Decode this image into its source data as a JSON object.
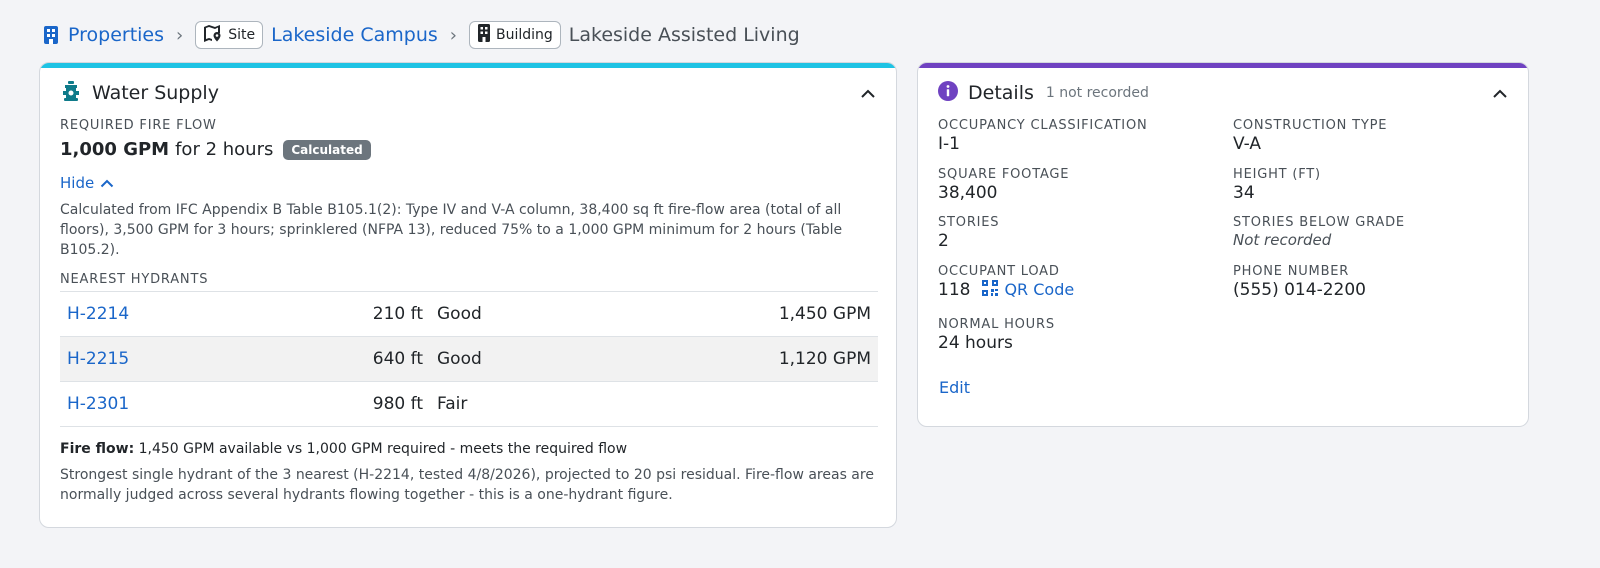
{
  "breadcrumb": {
    "properties": "Properties",
    "site_badge": "Site",
    "site_name": "Lakeside Campus",
    "building_badge": "Building",
    "building_name": "Lakeside Assisted Living"
  },
  "water_supply": {
    "accent_color": "#1ec3e4",
    "title": "Water Supply",
    "required_label": "REQUIRED FIRE FLOW",
    "flow_value": "1,000 GPM",
    "flow_duration": "for 2 hours",
    "calc_badge": "Calculated",
    "hide_label": "Hide",
    "calc_note": "Calculated from IFC Appendix B Table B105.1(2): Type IV and V-A column, 38,400 sq ft fire-flow area (total of all floors), 3,500 GPM for 3 hours; sprinklered (NFPA 13), reduced 75% to a 1,000 GPM minimum for 2 hours (Table B105.2).",
    "hydrants_label": "NEAREST HYDRANTS",
    "hydrants": [
      {
        "id": "H-2214",
        "distance": "210 ft",
        "condition": "Good",
        "gpm": "1,450 GPM"
      },
      {
        "id": "H-2215",
        "distance": "640 ft",
        "condition": "Good",
        "gpm": "1,120 GPM"
      },
      {
        "id": "H-2301",
        "distance": "980 ft",
        "condition": "Fair",
        "gpm": ""
      }
    ],
    "fire_flow_label": "Fire flow:",
    "fire_flow_text": "1,450 GPM available vs 1,000 GPM required - meets the required flow",
    "fire_flow_note": "Strongest single hydrant of the 3 nearest (H-2214, tested 4/8/2026), projected to 20 psi residual. Fire-flow areas are normally judged across several hydrants flowing together - this is a one-hydrant figure."
  },
  "details": {
    "accent_color": "#6f42c1",
    "title": "Details",
    "subtitle": "1 not recorded",
    "fields": {
      "occupancy_label": "OCCUPANCY CLASSIFICATION",
      "occupancy_value": "I-1",
      "construction_label": "CONSTRUCTION TYPE",
      "construction_value": "V-A",
      "sqft_label": "SQUARE FOOTAGE",
      "sqft_value": "38,400",
      "height_label": "HEIGHT (FT)",
      "height_value": "34",
      "stories_label": "STORIES",
      "stories_value": "2",
      "below_grade_label": "STORIES BELOW GRADE",
      "below_grade_value": "Not recorded",
      "occ_load_label": "OCCUPANT LOAD",
      "occ_load_value": "118",
      "qr_label": "QR Code",
      "phone_label": "PHONE NUMBER",
      "phone_value": "(555) 014-2200",
      "hours_label": "NORMAL HOURS",
      "hours_value": "24 hours"
    },
    "edit_label": "Edit"
  }
}
